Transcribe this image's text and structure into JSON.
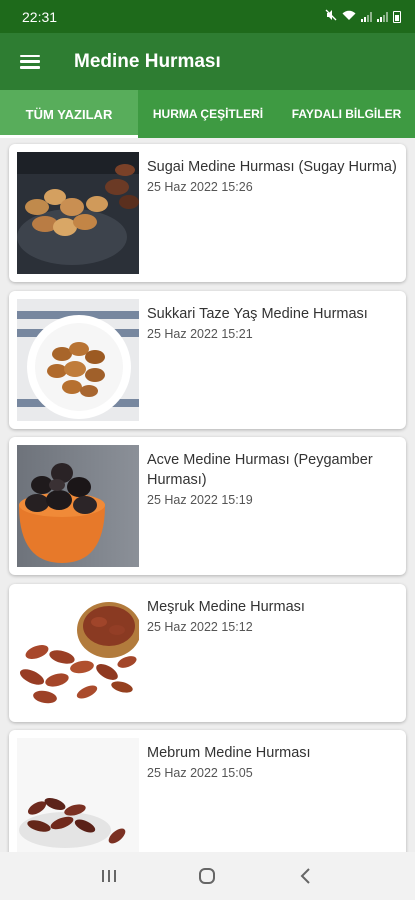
{
  "status_bar": {
    "time": "22:31",
    "icons": [
      "mute-icon",
      "wifi-icon",
      "signal-icon",
      "signal-icon",
      "battery-icon"
    ]
  },
  "app_bar": {
    "menu_icon": "hamburger-menu-icon",
    "title": "Medine Hurması"
  },
  "tabs": [
    {
      "label": "TÜM YAZILAR",
      "active": true
    },
    {
      "label": "HURMA ÇEŞİTLERİ",
      "active": false
    },
    {
      "label": "FAYDALI BİLGİLER",
      "active": false
    }
  ],
  "posts": [
    {
      "title": "Sugai Medine Hurması (Sugay Hurma)",
      "date": "25 Haz 2022 15:26",
      "image": "dates-on-dark-plate"
    },
    {
      "title": "Sukkari Taze Yaş Medine Hurması",
      "date": "25 Haz 2022 15:21",
      "image": "dates-on-white-plate"
    },
    {
      "title": "Acve Medine Hurması (Peygamber Hurması)",
      "date": "25 Haz 2022 15:19",
      "image": "black-dates-in-orange-bowl"
    },
    {
      "title": "Meşruk Medine Hurması",
      "date": "25 Haz 2022 15:12",
      "image": "dates-spilling-from-bowl"
    },
    {
      "title": "Mebrum Medine Hurması",
      "date": "25 Haz 2022 15:05",
      "image": "dates-in-white-bowl"
    }
  ],
  "nav_bar": {
    "icons": [
      "recent-apps-icon",
      "home-icon",
      "back-icon"
    ]
  },
  "colors": {
    "status_bar": "#1e6a1b",
    "app_bar": "#2e7d32",
    "tabs": "#3e9a42",
    "active_tab": "#58ad5b"
  }
}
